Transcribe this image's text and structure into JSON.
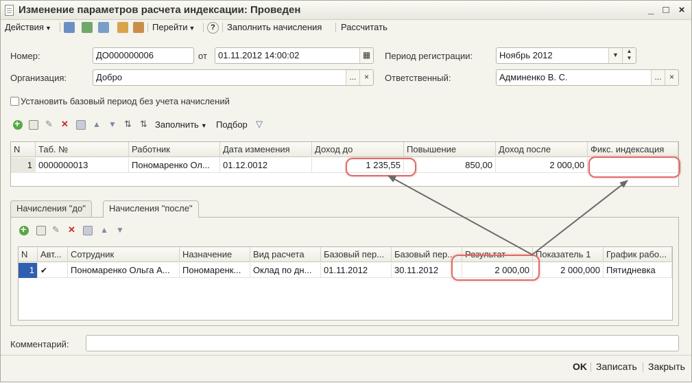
{
  "window": {
    "title": "Изменение параметров расчета индексации: Проведен",
    "controls": [
      "_",
      "□",
      "×"
    ]
  },
  "toolbar": {
    "actions_label": "Действия",
    "goto_label": "Перейти",
    "help_label": "?",
    "fill_accruals_label": "Заполнить начисления",
    "calculate_label": "Рассчитать"
  },
  "header": {
    "number_label": "Номер:",
    "number_value": "ДО000000006",
    "from_label": "от",
    "date_value": "01.11.2012 14:00:02",
    "period_label": "Период регистрации:",
    "period_value": "Ноябрь 2012",
    "org_label": "Организация:",
    "org_value": "Добро",
    "responsible_label": "Ответственный:",
    "responsible_value": "Админенко В. С.",
    "ellipsis": "...",
    "clear": "×",
    "base_period_checkbox_label": "Установить базовый период без учета начислений"
  },
  "grid_toolbar": {
    "fill_label": "Заполнить",
    "select_label": "Подбор"
  },
  "main_table": {
    "columns": [
      "N",
      "Таб. №",
      "Работник",
      "Дата изменения",
      "Доход до",
      "Повышение",
      "Доход после",
      "Фикс. индексация"
    ],
    "rows": [
      [
        "1",
        "0000000013",
        "Пономаренко Ол...",
        "01.12.0012",
        "1 235,55",
        "850,00",
        "2 000,00",
        ""
      ]
    ]
  },
  "tabs": [
    {
      "label": "Начисления \"до\"",
      "active": false
    },
    {
      "label": "Начисления \"после\"",
      "active": true
    }
  ],
  "accruals_table": {
    "columns": [
      "N",
      "Авт...",
      "Сотрудник",
      "Назначение",
      "Вид расчета",
      "Базовый пер...",
      "Базовый пер...",
      "Результат",
      "Показатель 1",
      "График рабо..."
    ],
    "rows": [
      [
        "1",
        "✔",
        "Пономаренко Ольга А...",
        "Пономаренк...",
        "Оклад по дн...",
        "01.11.2012",
        "30.11.2012",
        "2 000,00",
        "2 000,000",
        "Пятидневка"
      ]
    ]
  },
  "comment": {
    "label": "Комментарий:",
    "value": ""
  },
  "footer": {
    "ok_label": "OK",
    "save_label": "Записать",
    "close_label": "Закрыть"
  },
  "colors": {
    "highlight": "#e06a6a",
    "arrow": "#6b6b66",
    "selected_row": "#2f5fb0"
  }
}
